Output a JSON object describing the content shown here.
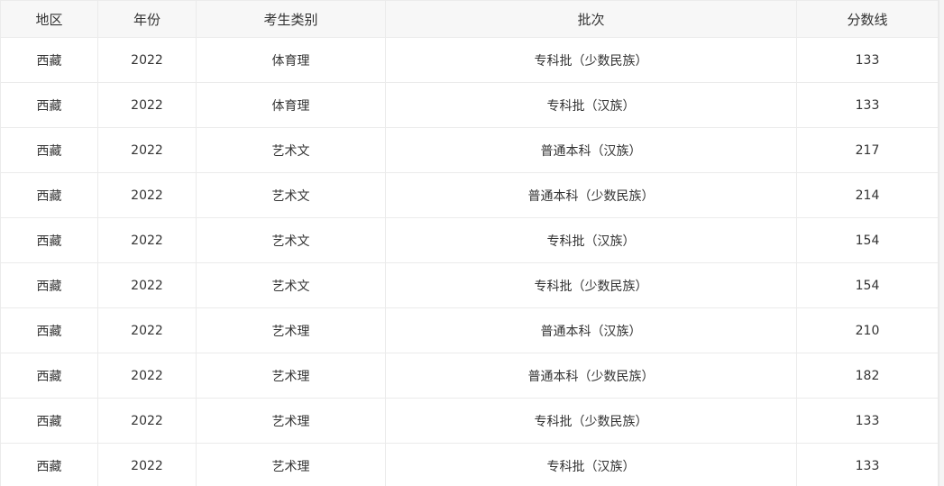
{
  "headers": [
    "地区",
    "年份",
    "考生类别",
    "批次",
    "分数线"
  ],
  "rows": [
    [
      "西藏",
      "2022",
      "体育理",
      "专科批（少数民族）",
      "133"
    ],
    [
      "西藏",
      "2022",
      "体育理",
      "专科批（汉族）",
      "133"
    ],
    [
      "西藏",
      "2022",
      "艺术文",
      "普通本科（汉族）",
      "217"
    ],
    [
      "西藏",
      "2022",
      "艺术文",
      "普通本科（少数民族）",
      "214"
    ],
    [
      "西藏",
      "2022",
      "艺术文",
      "专科批（汉族）",
      "154"
    ],
    [
      "西藏",
      "2022",
      "艺术文",
      "专科批（少数民族）",
      "154"
    ],
    [
      "西藏",
      "2022",
      "艺术理",
      "普通本科（汉族）",
      "210"
    ],
    [
      "西藏",
      "2022",
      "艺术理",
      "普通本科（少数民族）",
      "182"
    ],
    [
      "西藏",
      "2022",
      "艺术理",
      "专科批（少数民族）",
      "133"
    ],
    [
      "西藏",
      "2022",
      "艺术理",
      "专科批（汉族）",
      "133"
    ]
  ]
}
